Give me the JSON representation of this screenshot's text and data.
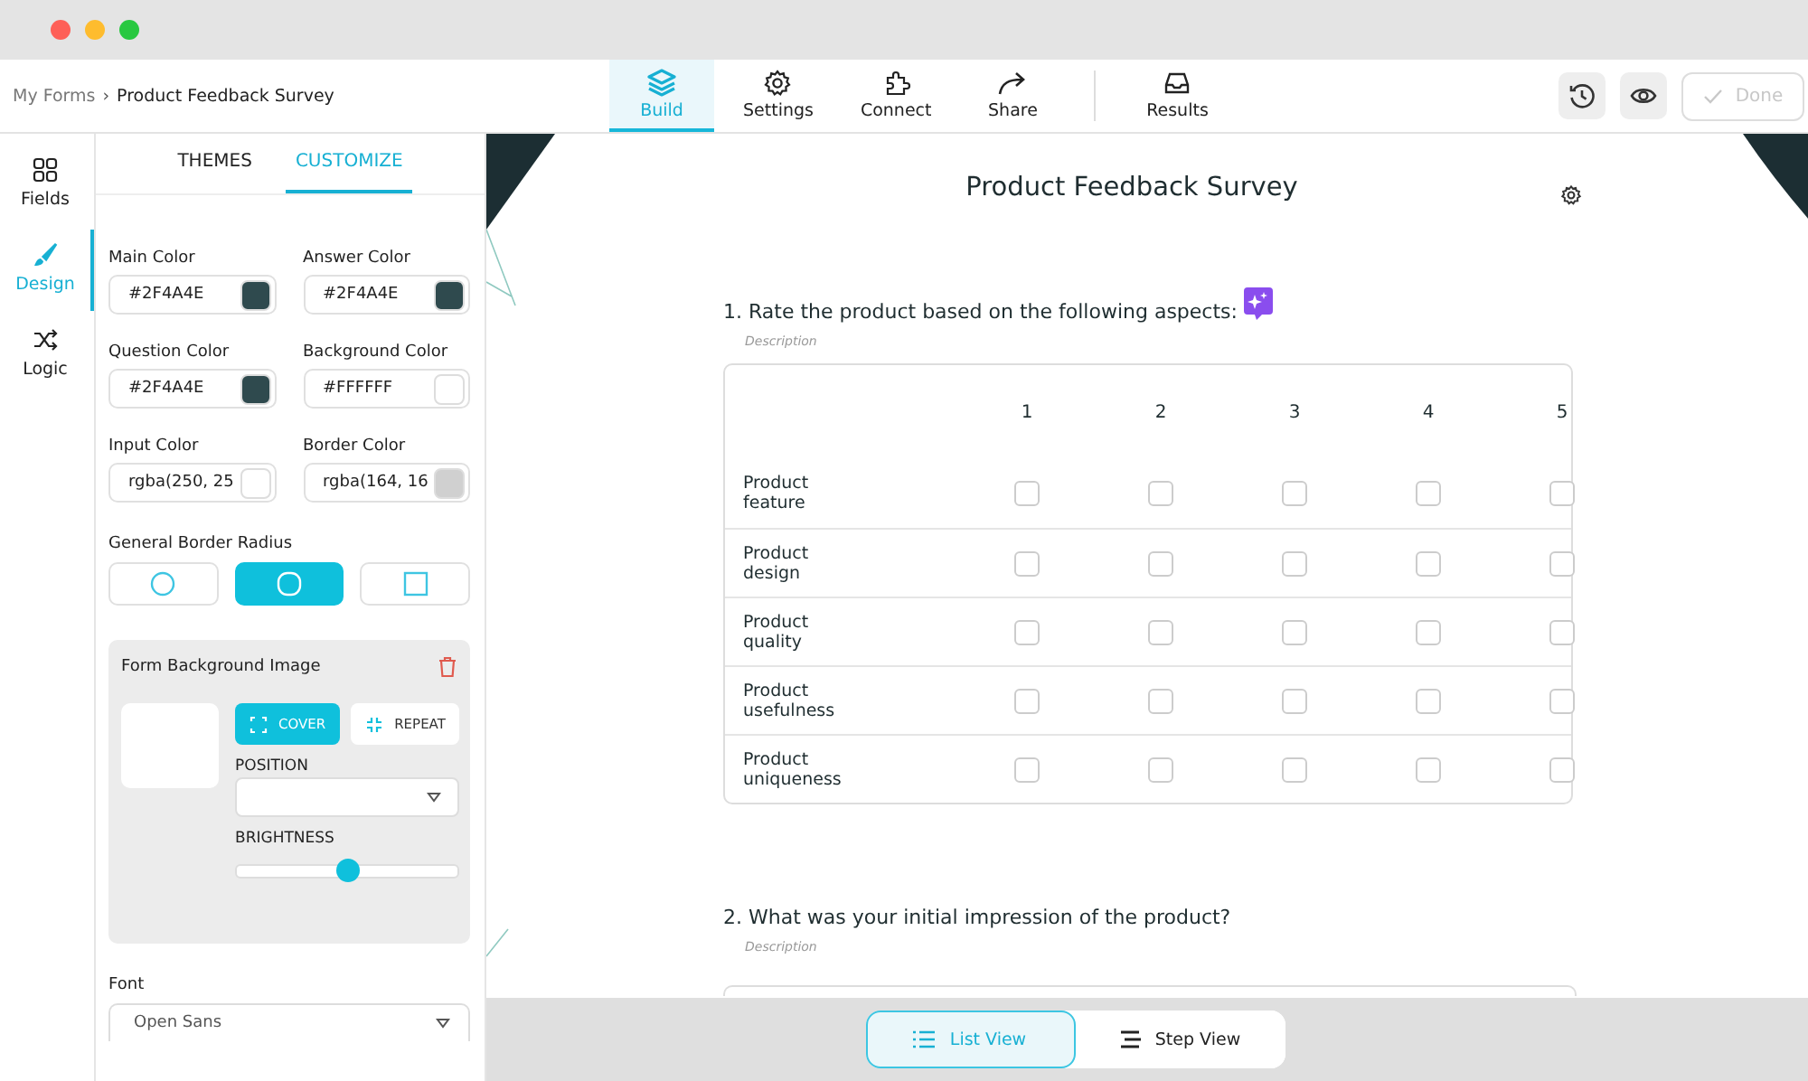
{
  "breadcrumb": {
    "parent": "My Forms",
    "separator": "›",
    "current": "Product Feedback Survey"
  },
  "nav": {
    "tabs": [
      {
        "label": "Build",
        "selected": true
      },
      {
        "label": "Settings",
        "selected": false
      },
      {
        "label": "Connect",
        "selected": false
      },
      {
        "label": "Share",
        "selected": false
      }
    ],
    "results": {
      "label": "Results",
      "selected": false
    }
  },
  "actions": {
    "done": {
      "label": "Done",
      "disabled": true
    }
  },
  "rail": [
    {
      "label": "Fields",
      "selected": false
    },
    {
      "label": "Design",
      "selected": true
    },
    {
      "label": "Logic",
      "selected": false
    }
  ],
  "panel_tabs": [
    {
      "label": "THEMES",
      "selected": false
    },
    {
      "label": "CUSTOMIZE",
      "selected": true
    }
  ],
  "colors": [
    {
      "label": "Main Color",
      "value": "#2F4A4E",
      "color": "#2f4a4e"
    },
    {
      "label": "Answer Color",
      "value": "#2F4A4E",
      "color": "#2f4a4e"
    },
    {
      "label": "Question Color",
      "value": "#2F4A4E",
      "color": "#2f4a4e"
    },
    {
      "label": "Background Color",
      "value": "#FFFFFF",
      "color": "#ffffff"
    },
    {
      "label": "Input Color",
      "value": "rgba(250, 25",
      "color": "#ffffff"
    },
    {
      "label": "Border Color",
      "value": "rgba(164, 16",
      "color": "#d0d0d0"
    }
  ],
  "border_radius": {
    "label": "General Border Radius",
    "options": [
      {
        "kind": "circle",
        "selected": false
      },
      {
        "kind": "rounded",
        "selected": true
      },
      {
        "kind": "square",
        "selected": false
      }
    ]
  },
  "background_image": {
    "title": "Form Background Image",
    "modes": [
      {
        "label": "COVER",
        "selected": true
      },
      {
        "label": "REPEAT",
        "selected": false
      }
    ],
    "position_label": "POSITION",
    "brightness_label": "BRIGHTNESS",
    "level": 0.5
  },
  "font": {
    "label": "Font",
    "value": "Open Sans"
  },
  "survey": {
    "title": "Product Feedback Survey",
    "questions": [
      {
        "kind": "matrix",
        "number": "1.",
        "text": "Rate the product based on the following aspects:",
        "description": "Description",
        "columns": [
          "1",
          "2",
          "3",
          "4",
          "5"
        ],
        "rows": [
          {
            "label": "Product feature",
            "checked": [
              false,
              false,
              false,
              false,
              false
            ]
          },
          {
            "label": "Product design",
            "checked": [
              false,
              false,
              false,
              false,
              false
            ]
          },
          {
            "label": "Product quality",
            "checked": [
              false,
              false,
              false,
              false,
              false
            ]
          },
          {
            "label": "Product usefulness",
            "checked": [
              false,
              false,
              false,
              false,
              false
            ]
          },
          {
            "label": "Product uniqueness",
            "checked": [
              false,
              false,
              false,
              false,
              false
            ]
          }
        ]
      },
      {
        "kind": "text",
        "number": "2.",
        "text": "What was your initial impression of the product?",
        "description": "Description"
      }
    ]
  },
  "view_toggle": [
    {
      "label": "List View",
      "selected": true
    },
    {
      "label": "Step View",
      "selected": false
    }
  ]
}
